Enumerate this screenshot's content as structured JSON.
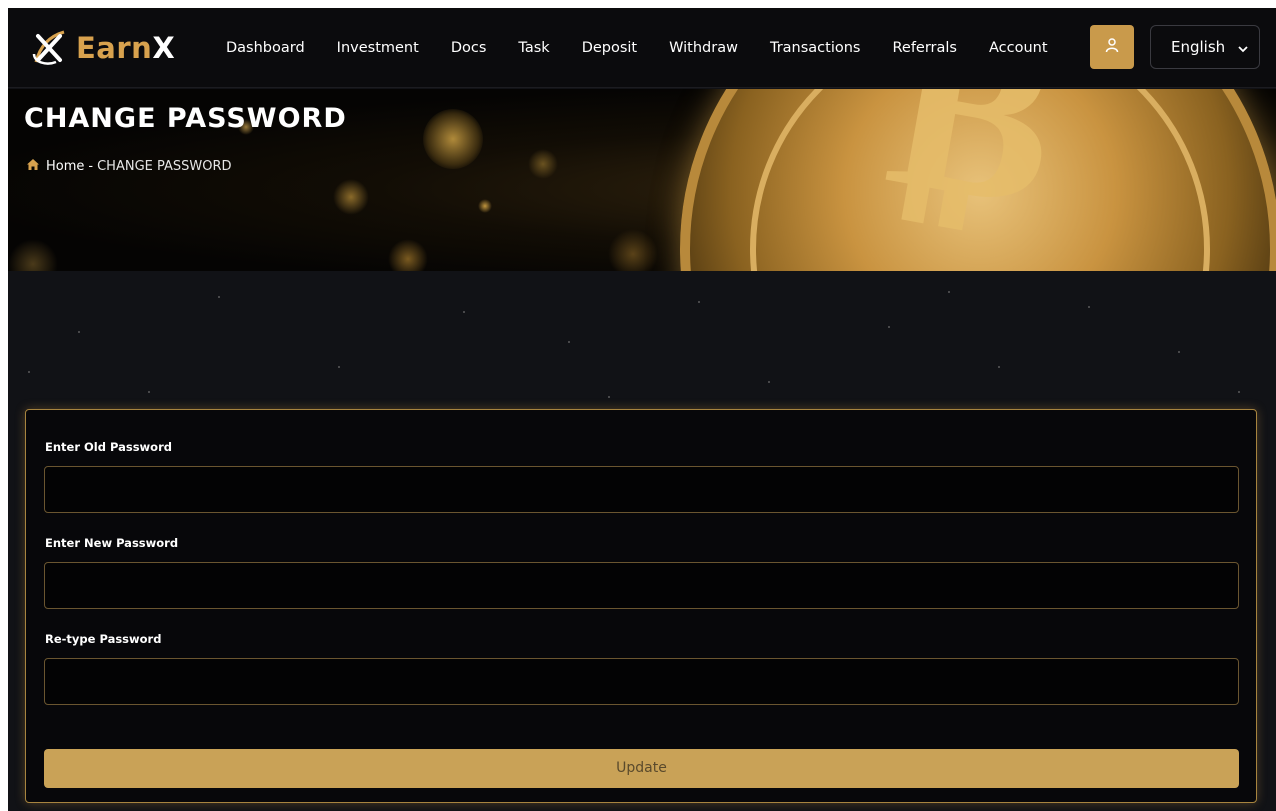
{
  "brand": {
    "name_prefix": "Earn",
    "name_suffix": "X",
    "logo_icon": "earnx-logo-icon"
  },
  "nav": {
    "items": [
      {
        "label": "Dashboard"
      },
      {
        "label": "Investment"
      },
      {
        "label": "Docs"
      },
      {
        "label": "Task"
      },
      {
        "label": "Deposit"
      },
      {
        "label": "Withdraw"
      },
      {
        "label": "Transactions"
      },
      {
        "label": "Referrals"
      },
      {
        "label": "Account"
      }
    ],
    "user_icon": "user-icon",
    "language": "English"
  },
  "banner": {
    "title": "CHANGE PASSWORD",
    "breadcrumb": {
      "home": "Home",
      "separator": "-",
      "current": "CHANGE PASSWORD"
    }
  },
  "form": {
    "old_password_label": "Enter Old Password",
    "new_password_label": "Enter New Password",
    "retype_password_label": "Re-type Password",
    "old_password_value": "",
    "new_password_value": "",
    "retype_password_value": "",
    "submit_label": "Update"
  },
  "colors": {
    "accent": "#c9a257",
    "accent_dark": "#d8a24e",
    "background": "#111216",
    "card_background": "#07070a",
    "card_border": "#a7843f"
  }
}
